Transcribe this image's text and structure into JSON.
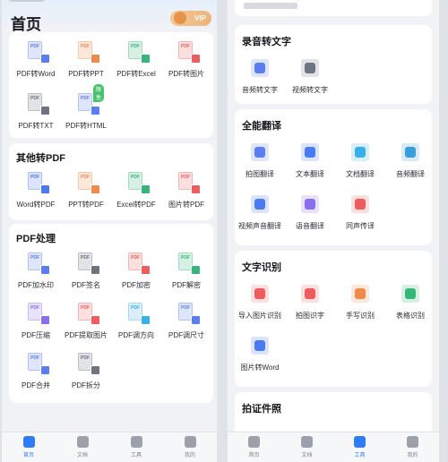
{
  "left_screen": {
    "title": "首页",
    "vip_label": "VIP",
    "sections": [
      {
        "title": "",
        "items": [
          {
            "label": "PDF转Word",
            "icon": "pdf-to-word-icon",
            "color": "#5b7ff0"
          },
          {
            "label": "PDF转PPT",
            "icon": "pdf-to-ppt-icon",
            "color": "#f08a4a"
          },
          {
            "label": "PDF转Excel",
            "icon": "pdf-to-excel-icon",
            "color": "#38b67a"
          },
          {
            "label": "PDF转图片",
            "icon": "pdf-to-image-icon",
            "color": "#ee5d5d"
          },
          {
            "label": "PDF转TXT",
            "icon": "pdf-to-txt-icon",
            "color": "#6e7480"
          },
          {
            "label": "PDF转HTML",
            "icon": "pdf-to-html-icon",
            "color": "#5b7ff0",
            "tag": "限免"
          }
        ]
      },
      {
        "title": "其他转PDF",
        "items": [
          {
            "label": "Word转PDF",
            "icon": "word-to-pdf-icon",
            "color": "#4a7af0"
          },
          {
            "label": "PPT转PDF",
            "icon": "ppt-to-pdf-icon",
            "color": "#f08a4a"
          },
          {
            "label": "Excel转PDF",
            "icon": "excel-to-pdf-icon",
            "color": "#38b67a"
          },
          {
            "label": "图片转PDF",
            "icon": "image-to-pdf-icon",
            "color": "#ee5d5d"
          }
        ]
      },
      {
        "title": "PDF处理",
        "items": [
          {
            "label": "PDF加水印",
            "icon": "watermark-icon",
            "color": "#5b7ff0"
          },
          {
            "label": "PDF签名",
            "icon": "signature-icon",
            "color": "#6e7480"
          },
          {
            "label": "PDF加密",
            "icon": "lock-icon",
            "color": "#ee5d5d"
          },
          {
            "label": "PDF解密",
            "icon": "unlock-icon",
            "color": "#38b67a"
          },
          {
            "label": "PDF压缩",
            "icon": "compress-icon",
            "color": "#8a6ef0"
          },
          {
            "label": "PDF提取图片",
            "icon": "extract-image-icon",
            "color": "#ee5d5d"
          },
          {
            "label": "PDF调方向",
            "icon": "rotate-icon",
            "color": "#3ab0e8"
          },
          {
            "label": "PDF调尺寸",
            "icon": "resize-icon",
            "color": "#5b7ff0"
          },
          {
            "label": "PDF合并",
            "icon": "merge-icon",
            "color": "#5b7ff0"
          },
          {
            "label": "PDF拆分",
            "icon": "split-icon",
            "color": "#6e7480"
          }
        ]
      }
    ],
    "tabs": [
      {
        "label": "首页",
        "active": true
      },
      {
        "label": "文档",
        "active": false
      },
      {
        "label": "工具",
        "active": false
      },
      {
        "label": "我的",
        "active": false
      }
    ]
  },
  "right_screen": {
    "sections": [
      {
        "title": "录音转文字",
        "items": [
          {
            "label": "音频转文字",
            "icon": "audio-to-text-icon",
            "color": "#5b7ff0"
          },
          {
            "label": "视频转文字",
            "icon": "video-to-text-icon",
            "color": "#6e7480"
          }
        ]
      },
      {
        "title": "全能翻译",
        "items": [
          {
            "label": "拍图翻译",
            "icon": "camera-translate-icon",
            "color": "#5b7ff0"
          },
          {
            "label": "文本翻译",
            "icon": "text-translate-icon",
            "color": "#4a7af0"
          },
          {
            "label": "文档翻译",
            "icon": "doc-translate-icon",
            "color": "#3ab0e8"
          },
          {
            "label": "音频翻译",
            "icon": "audio-translate-icon",
            "color": "#3a9ed8"
          },
          {
            "label": "视频声音翻译",
            "icon": "video-translate-icon",
            "color": "#4a7af0"
          },
          {
            "label": "语音翻译",
            "icon": "voice-translate-icon",
            "color": "#8a6ef0"
          },
          {
            "label": "同声传译",
            "icon": "simultaneous-icon",
            "color": "#ee5d5d"
          }
        ]
      },
      {
        "title": "文字识别",
        "items": [
          {
            "label": "导入图片识别",
            "icon": "import-image-ocr-icon",
            "color": "#ee5d5d"
          },
          {
            "label": "拍图识字",
            "icon": "camera-ocr-icon",
            "color": "#ee5d5d"
          },
          {
            "label": "手写识别",
            "icon": "handwriting-icon",
            "color": "#f08a4a"
          },
          {
            "label": "表格识别",
            "icon": "table-ocr-icon",
            "color": "#38b67a"
          },
          {
            "label": "图片转Word",
            "icon": "image-to-word-icon",
            "color": "#4a7af0"
          }
        ]
      },
      {
        "title": "拍证件照",
        "items": []
      }
    ],
    "tabs": [
      {
        "label": "首页",
        "active": false
      },
      {
        "label": "文档",
        "active": false
      },
      {
        "label": "工具",
        "active": true
      },
      {
        "label": "我的",
        "active": false
      }
    ]
  }
}
